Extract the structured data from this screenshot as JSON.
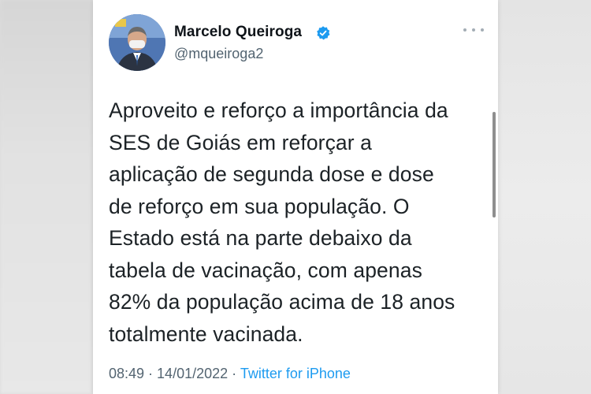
{
  "tweet": {
    "author": {
      "name": "Marcelo Queiroga",
      "handle": "@mqueiroga2",
      "verified": true
    },
    "text": "Aproveito e reforço a importância da\nSES de Goiás em reforçar a\naplicação de segunda dose e dose\nde reforço em sua população. O\nEstado está na parte debaixo da\ntabela de vacinação, com apenas\n82% da população acima de 18 anos\ntotalmente vacinada.",
    "time": "08:49",
    "separator_1": " · ",
    "date": "14/01/2022",
    "separator_2": " · ",
    "source": "Twitter for iPhone"
  },
  "icons": {
    "verified": "verified-badge-icon",
    "more": "more-options-icon"
  },
  "colors": {
    "name": "#0f1419",
    "secondary": "#536471",
    "link": "#1d9bf0",
    "verified": "#1d9bf0"
  }
}
